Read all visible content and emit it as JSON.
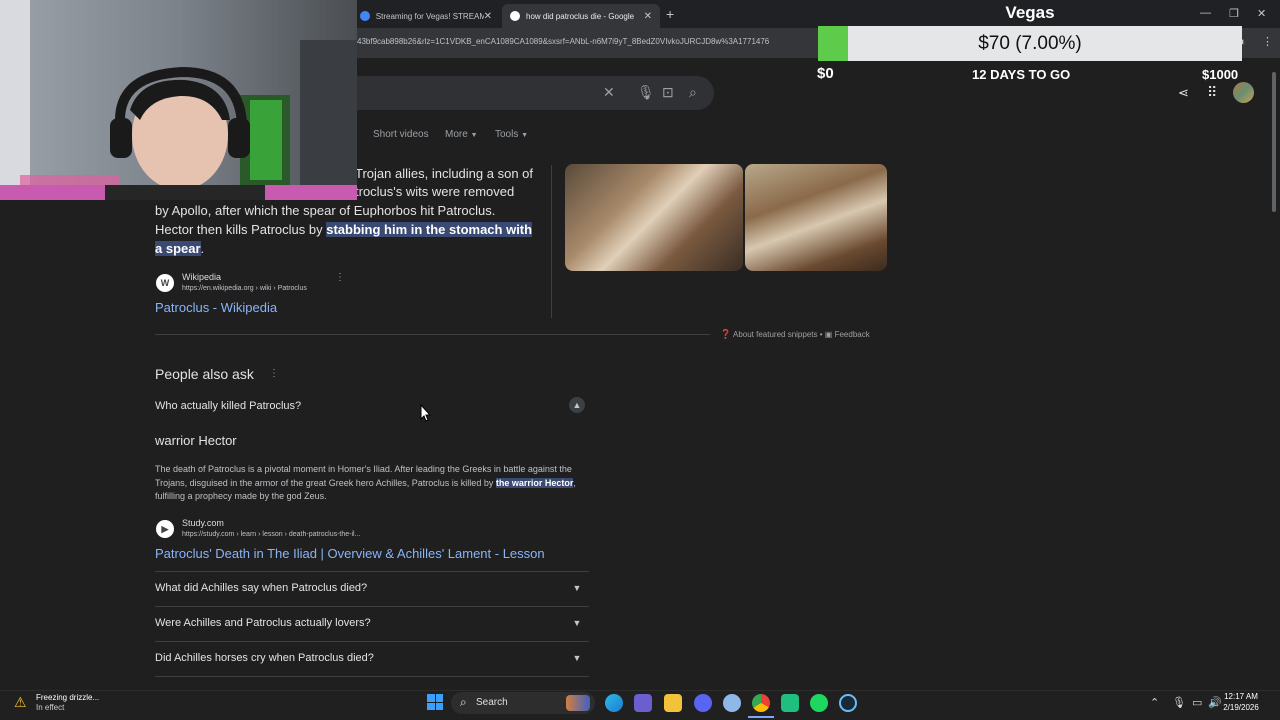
{
  "browser": {
    "tabs": [
      {
        "title": "Streaming for Vegas! STREAM"
      },
      {
        "title": "how did patroclus die - Google"
      }
    ],
    "url": "43bf9cab898b26&rlz=1C1VDKB_enCA1089CA1089&sxsrf=ANbL-n6M7i9yT_8BedZ0VIvkoJURCJD8w%3A1771476"
  },
  "google": {
    "tabs": [
      "Short videos",
      "More",
      "Tools"
    ],
    "snippet": {
      "line1": "Trojan allies, including a son of",
      "line2": "troclus's wits were removed",
      "line3": "by Apollo, after which the spear of Euphorbos hit Patroclus.",
      "line4_plain": "Hector then kills Patroclus by ",
      "line4_hl": "stabbing him in the stomach with",
      "line5_hl": "a spear",
      "line5_end": ".",
      "source_name": "Wikipedia",
      "source_url": "https://en.wikipedia.org › wiki › Patroclus",
      "link": "Patroclus - Wikipedia",
      "about": "About featured snippets",
      "feedback": "Feedback"
    },
    "paa": {
      "title": "People also ask",
      "open_question": "Who actually killed Patroclus?",
      "answer_title": "warrior Hector",
      "answer_text_1": "The death of Patroclus is a pivotal moment in Homer's Iliad. After leading the Greeks in battle against the Trojans, disguised in the armor of the great Greek hero Achilles, Patroclus is killed by ",
      "answer_hl": "the warrior Hector",
      "answer_text_2": ", fulfilling a prophecy made by the god Zeus.",
      "answer_source": "Study.com",
      "answer_url": "https://study.com › learn › lesson › death-patroclus-the-il...",
      "answer_link": "Patroclus' Death in The Iliad | Overview & Achilles' Lament - Lesson",
      "questions": [
        "What did Achilles say when Patroclus died?",
        "Were Achilles and Patroclus actually lovers?",
        "Did Achilles horses cry when Patroclus died?"
      ]
    }
  },
  "vegas": {
    "title": "Vegas",
    "amount": "$70 (7.00%)",
    "progress": 0.07,
    "min": "$0",
    "days": "12 DAYS TO GO",
    "max": "$1000"
  },
  "taskbar": {
    "weather_line1": "Freezing drizzle...",
    "weather_line2": "In effect",
    "search": "Search",
    "time": "12:17 AM",
    "date": "2/19/2026"
  },
  "colors": {
    "accent_link": "#8ab4f8",
    "progress_fill": "#5ecb4a",
    "highlight": "#3b4a73"
  }
}
